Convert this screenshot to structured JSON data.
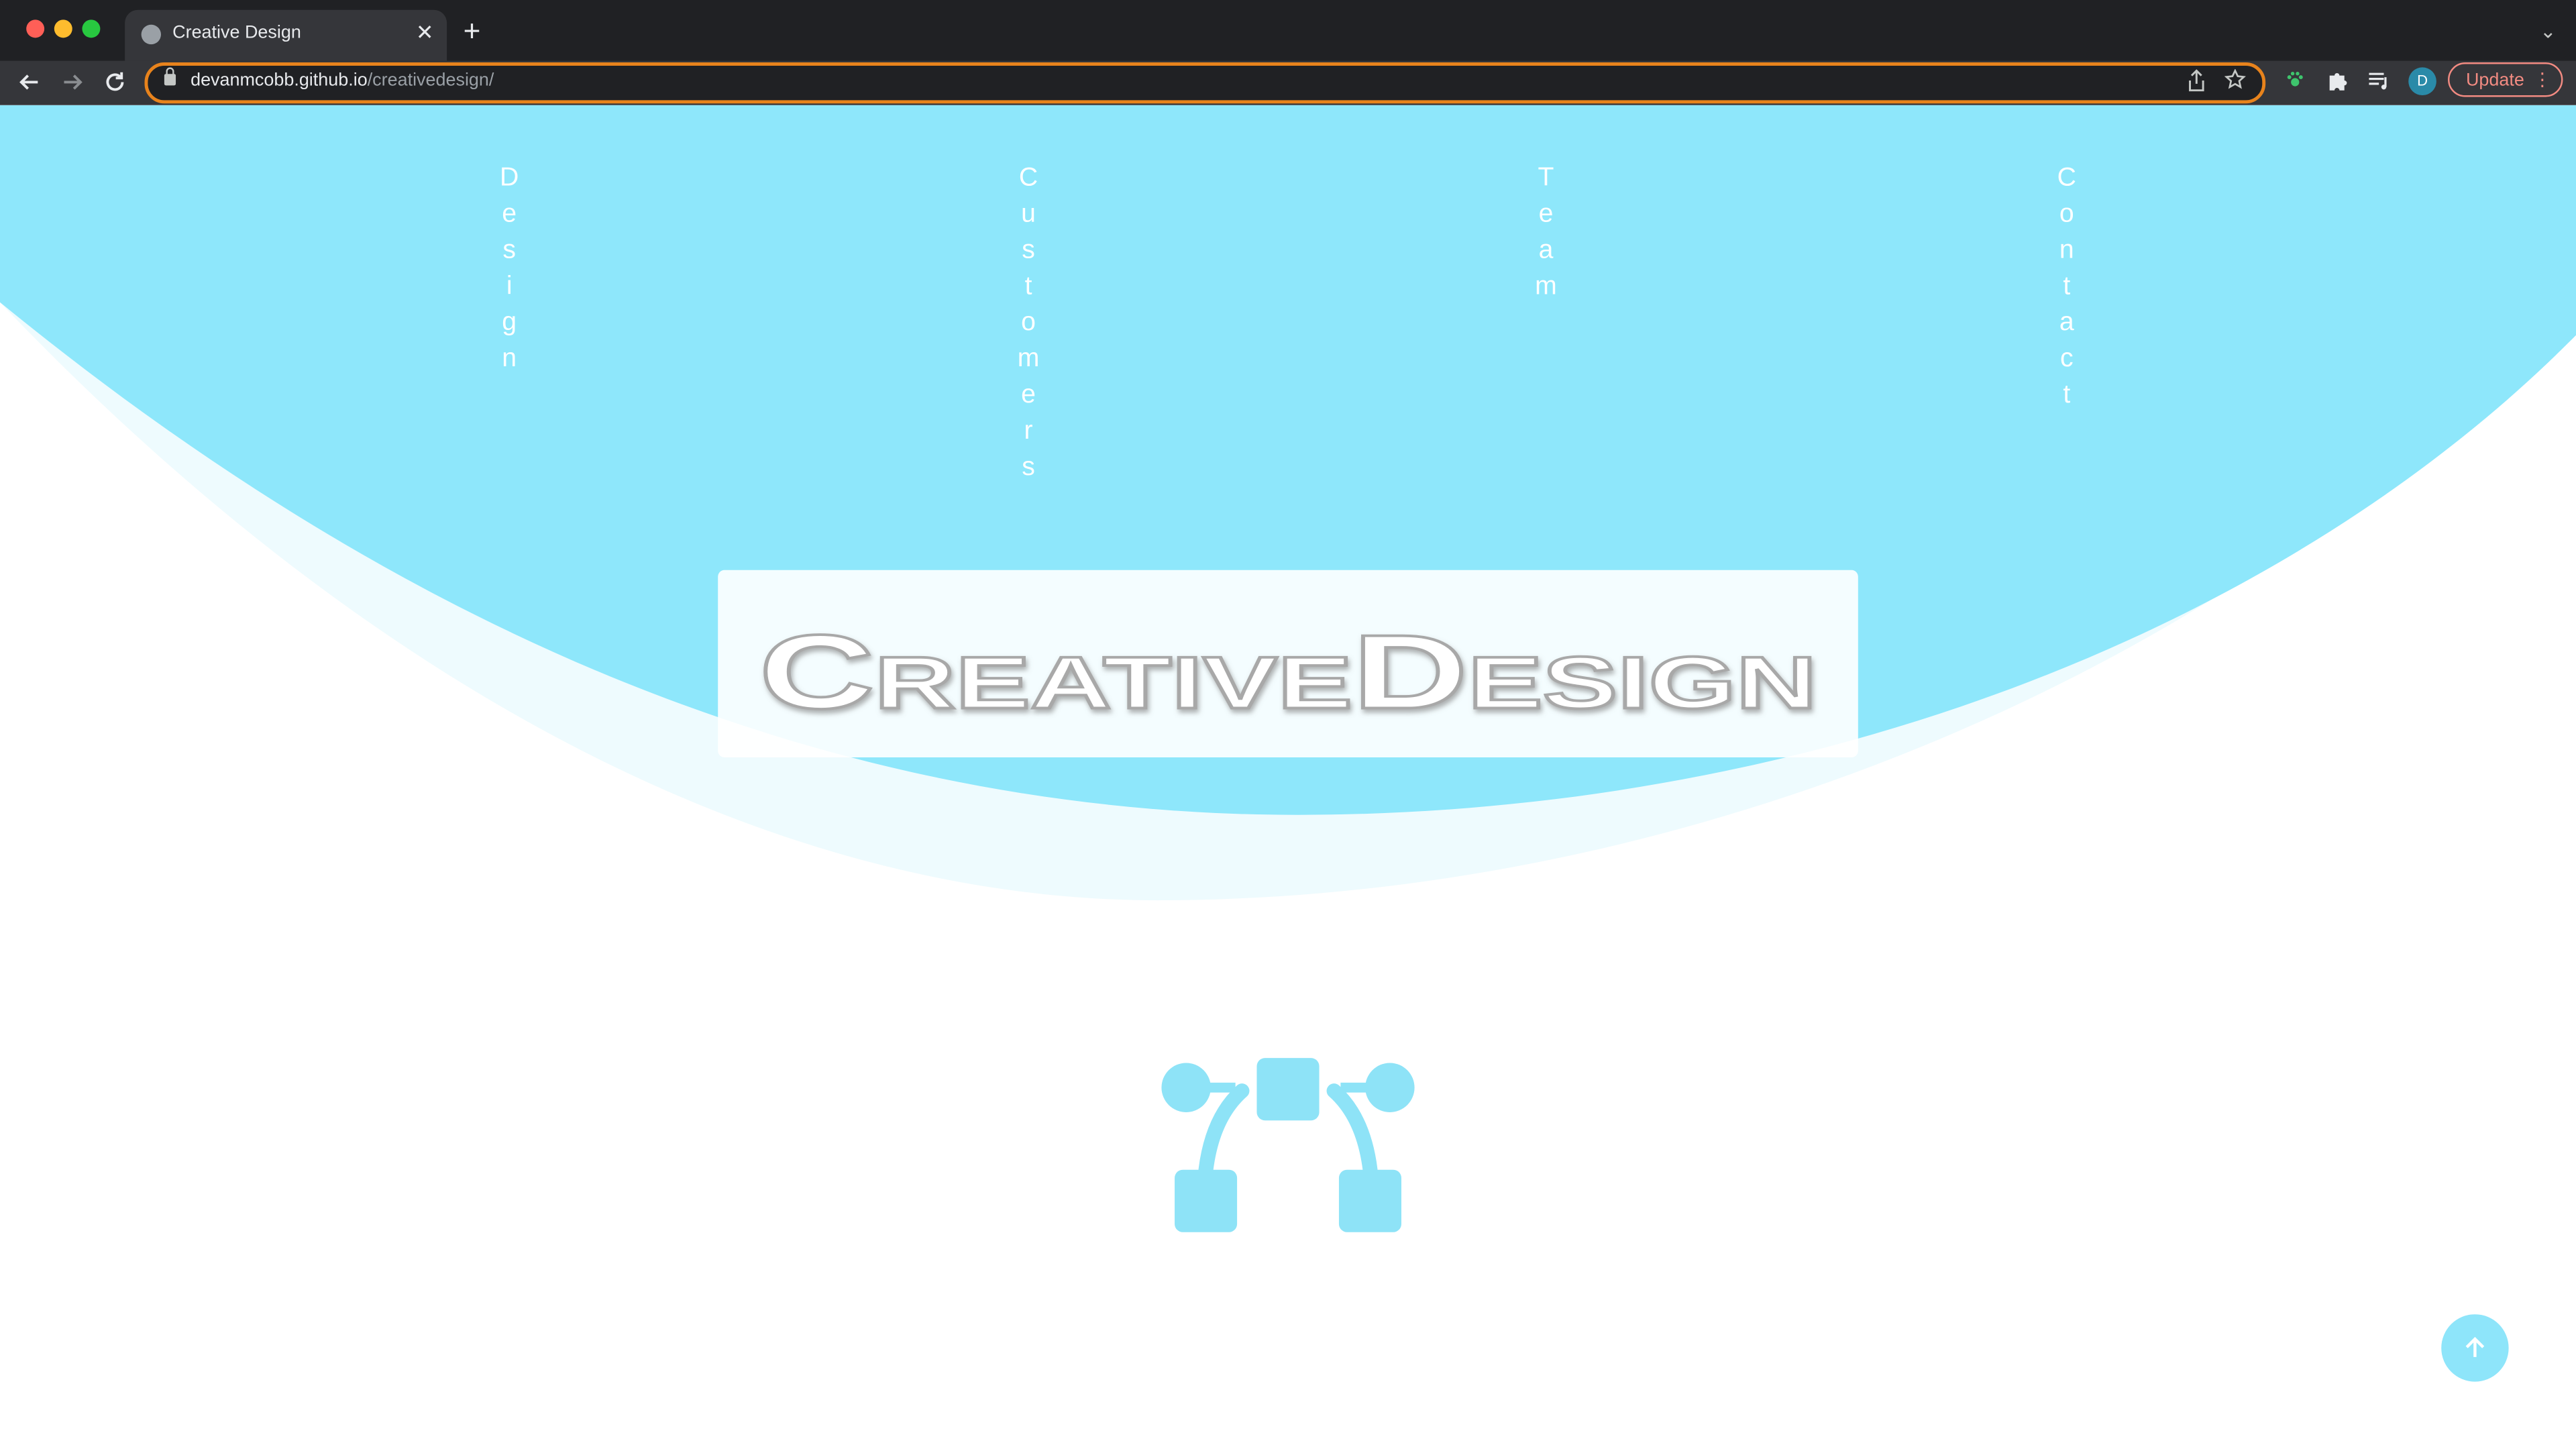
{
  "browser": {
    "tab_title": "Creative Design",
    "tab_close": "✕",
    "new_tab": "+",
    "tab_menu": "⌄",
    "url_host": "devanmcobb.github.io",
    "url_path": "/creativedesign/",
    "avatar_initial": "D",
    "update_label": "Update",
    "update_menu": "⋮",
    "icons": {
      "back": "back-arrow-icon",
      "forward": "forward-arrow-icon",
      "reload": "reload-icon",
      "lock": "lock-icon",
      "share": "share-icon",
      "star": "star-icon",
      "extension": "paw-extension-icon",
      "puzzle": "puzzle-icon",
      "media": "media-playlist-icon"
    }
  },
  "site": {
    "nav": {
      "design": "Design",
      "customers": "Customers",
      "team": "Team",
      "contact": "Contact"
    },
    "hero_title": "CreativeDesign",
    "feature_icon": "vector-design-icon",
    "scroll_top_icon": "arrow-up-icon",
    "colors": {
      "accent": "#8ee7fb",
      "wave_light": "#eefbfe",
      "nav_text": "#ffffff"
    }
  }
}
